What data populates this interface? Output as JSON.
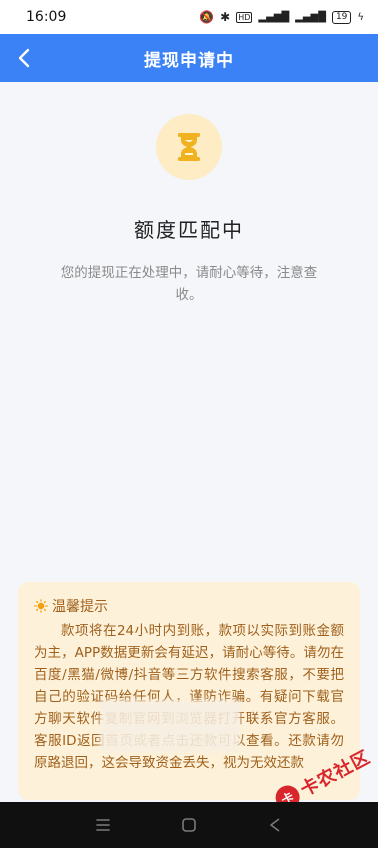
{
  "status_bar": {
    "time": "16:09",
    "battery": "19",
    "icons": [
      "mute-icon",
      "bluetooth-icon",
      "hd-icon",
      "signal-4g-icon",
      "signal-5g-icon",
      "battery-icon",
      "charging-icon"
    ]
  },
  "header": {
    "title": "提现申请中",
    "back_icon": "chevron-left-icon"
  },
  "status": {
    "icon": "hourglass-icon",
    "title": "额度匹配中",
    "description": "您的提现正在处理中，请耐心等待，注意查收。"
  },
  "tip": {
    "icon": "lightbulb-icon",
    "heading": "温馨提示",
    "body": "款项将在24小时内到账，款项以实际到账金额为主，APP数据更新会有延迟，请耐心等待。请勿在百度/黑猫/微博/抖音等三方软件搜索客服，不要把自己的验证码给任何人，谨防诈骗。有疑问下载官方聊天软件复制官网到浏览器打开联系官方客服。客服ID返回首页或者点击还款可以查看。还款请勿原路退回，这会导致资金丢失，视为无效还款"
  },
  "watermark": {
    "logo_text": "卡",
    "text": "卡农社区"
  },
  "colors": {
    "header_bg": "#3b82f6",
    "tip_bg": "#fdf2d9",
    "tip_text": "#a0601c",
    "hourglass": "#f0b21e"
  }
}
